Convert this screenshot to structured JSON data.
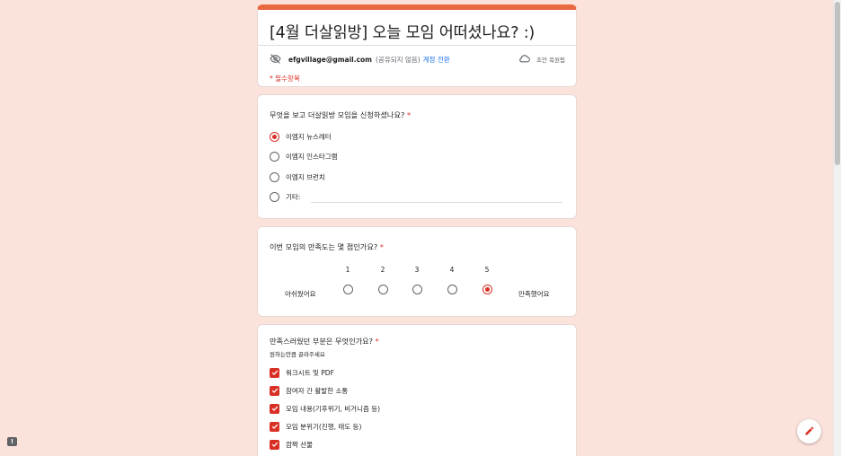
{
  "form": {
    "title": "[4월 더살읽방] 오늘 모임 어떠셨나요? :)",
    "account_email": "efgvillage@gmail.com",
    "account_note": "(공유되지 않음)",
    "switch_account": "계정 전환",
    "draft_status": "초안 복원됨",
    "required_note": "* 필수항목",
    "accent_color": "#e8693f"
  },
  "q1": {
    "title": "무엇을 보고 더살읽방 모임을 신청하셨나요?",
    "required_mark": "*",
    "options": [
      {
        "label": "이엠지 뉴스레터",
        "selected": true
      },
      {
        "label": "이엠지 인스타그램",
        "selected": false
      },
      {
        "label": "이엠지 브런치",
        "selected": false
      },
      {
        "label": "기타:",
        "selected": false
      }
    ]
  },
  "q2": {
    "title": "이번 모임의 만족도는 몇 점인가요?",
    "required_mark": "*",
    "scale": [
      "1",
      "2",
      "3",
      "4",
      "5"
    ],
    "selected": "5",
    "low_label": "아쉬웠어요",
    "high_label": "만족했어요"
  },
  "q3": {
    "title": "만족스러웠던 부분은 무엇인가요?",
    "required_mark": "*",
    "help_text": "원하는만큼 골라주세요",
    "options": [
      {
        "label": "워크시트 및 PDF",
        "checked": true
      },
      {
        "label": "참여자 간 활발한 소통",
        "checked": true
      },
      {
        "label": "모임 내용(기후위기, 비거니즘 등)",
        "checked": true
      },
      {
        "label": "모임 분위기(진행, 태도 등)",
        "checked": true
      },
      {
        "label": "깜짝 선물",
        "checked": true
      }
    ]
  }
}
